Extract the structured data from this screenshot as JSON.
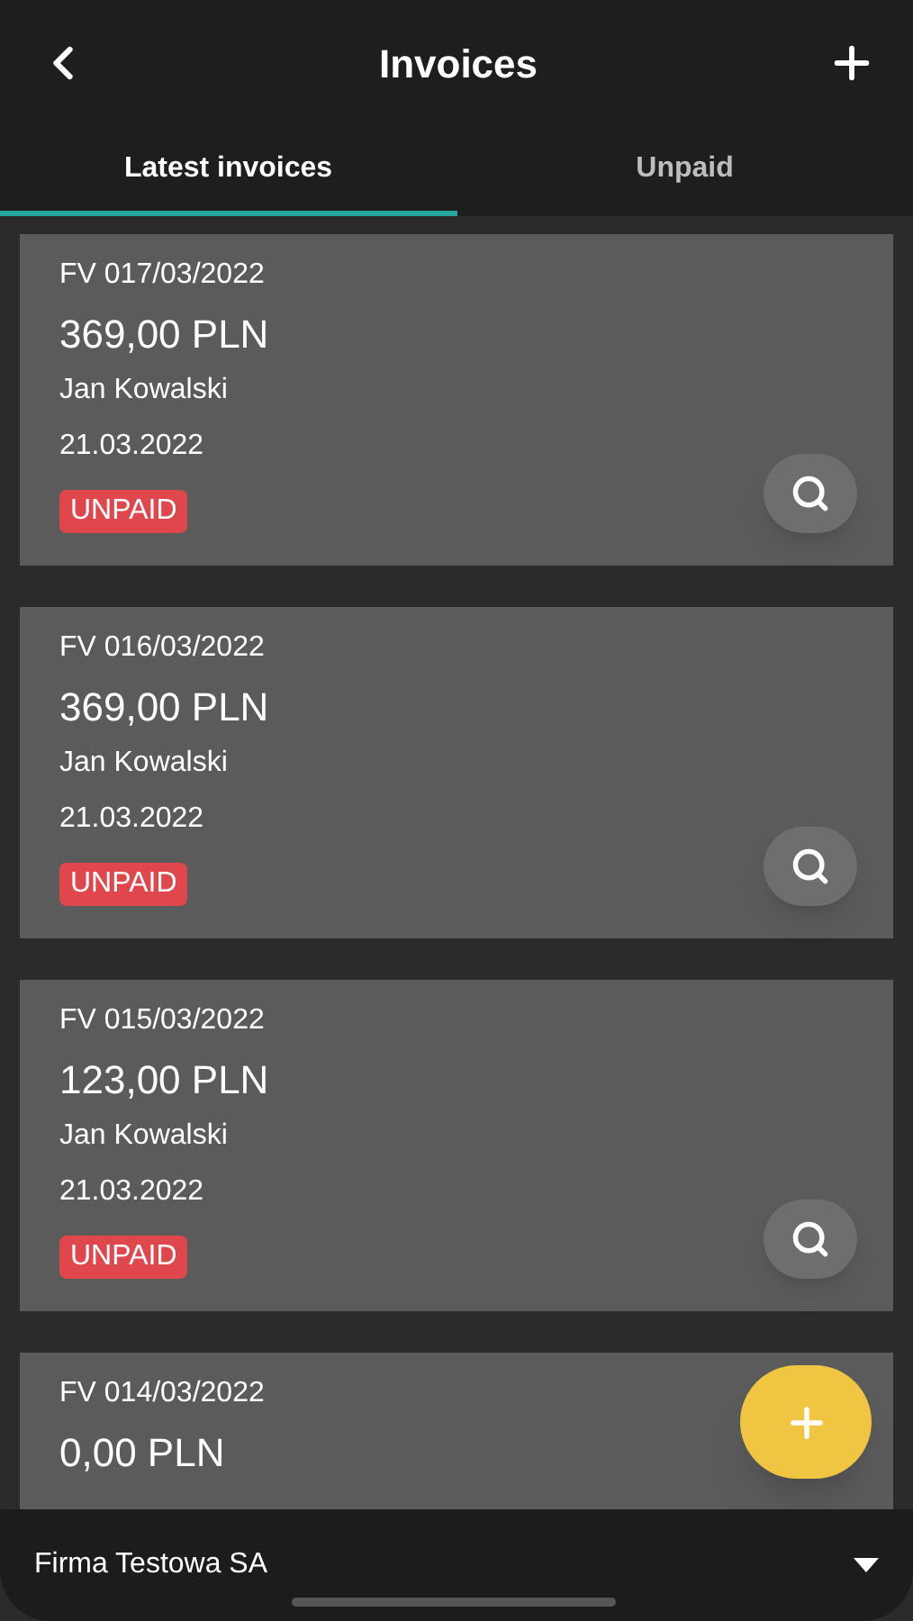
{
  "header": {
    "title": "Invoices"
  },
  "tabs": [
    {
      "label": "Latest invoices",
      "selected": true
    },
    {
      "label": "Unpaid",
      "selected": false
    }
  ],
  "invoices": [
    {
      "number": "FV 017/03/2022",
      "amount": "369,00 PLN",
      "client": "Jan Kowalski",
      "date": "21.03.2022",
      "status": "UNPAID"
    },
    {
      "number": "FV 016/03/2022",
      "amount": "369,00 PLN",
      "client": "Jan Kowalski",
      "date": "21.03.2022",
      "status": "UNPAID"
    },
    {
      "number": "FV 015/03/2022",
      "amount": "123,00 PLN",
      "client": "Jan Kowalski",
      "date": "21.03.2022",
      "status": "UNPAID"
    },
    {
      "number": "FV 014/03/2022",
      "amount": "0,00 PLN"
    }
  ],
  "company": {
    "name": "Firma Testowa SA"
  }
}
